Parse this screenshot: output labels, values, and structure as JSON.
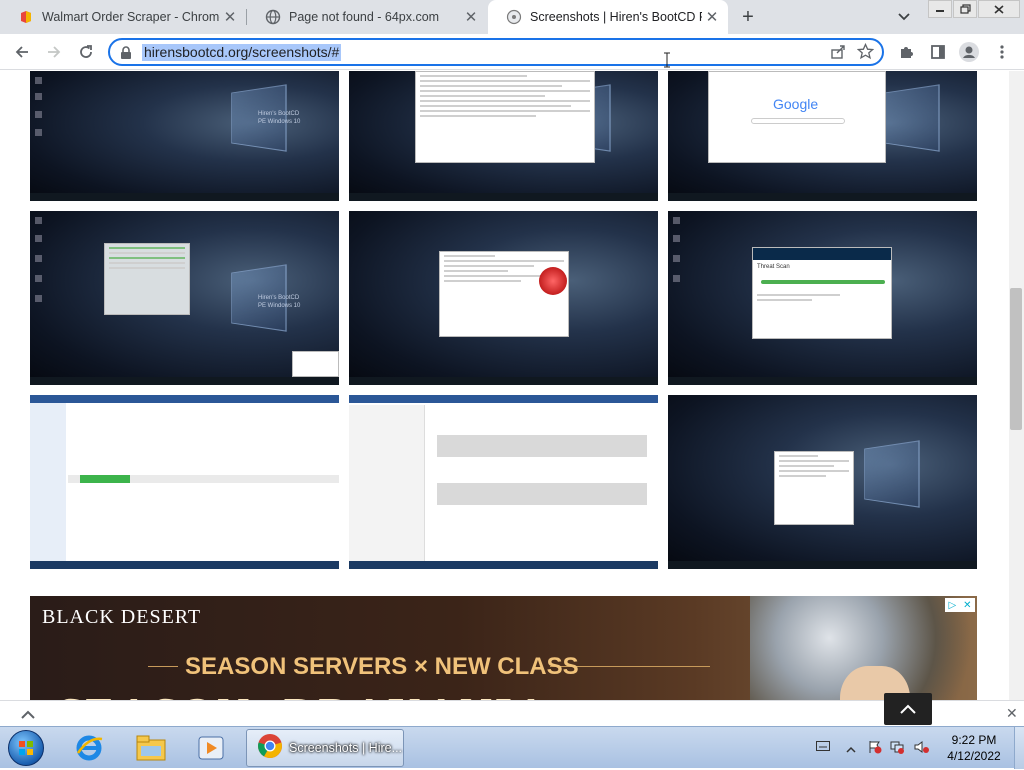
{
  "tabs": [
    {
      "title": "Walmart Order Scraper - Chrome",
      "icon": "extension-favicon-icon",
      "active": false
    },
    {
      "title": "Page not found - 64px.com",
      "icon": "globe-icon",
      "active": false
    },
    {
      "title": "Screenshots | Hiren's BootCD PE",
      "icon": "hirens-favicon-icon",
      "active": true
    }
  ],
  "address_bar": {
    "url": "hirensbootcd.org/screenshots/#"
  },
  "screenshot_labels": {
    "hirens_line1": "Hiren's BootCD",
    "hirens_line2": "PE Windows 10",
    "google": "Google",
    "threat_scan": "Threat Scan"
  },
  "ad": {
    "brand": "BLACK DESERT",
    "headline": "SEASON SERVERS × NEW CLASS",
    "big_text": "SEASON: DRAKANIA"
  },
  "taskbar": {
    "chrome_label": "Screenshots | Hire...",
    "time": "9:22 PM",
    "date": "4/12/2022"
  },
  "colors": {
    "accent": "#1a73e8",
    "url_selection": "#a8c7fa",
    "ad_gold": "#f0c27a"
  }
}
